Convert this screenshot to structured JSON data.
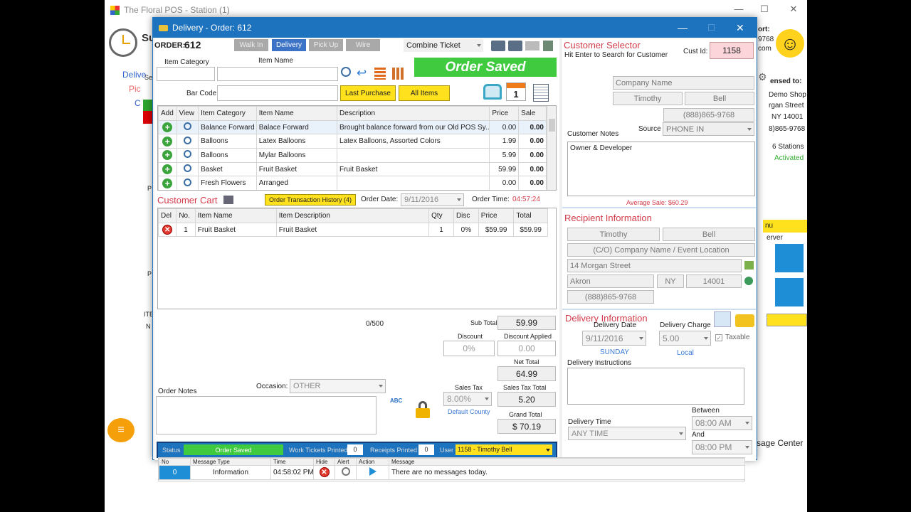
{
  "main_window": {
    "title": "The Floral POS - Station (1)",
    "side_labels": [
      "Su",
      "Delive",
      "Pic",
      "C",
      "P",
      "P",
      "ITE",
      "N",
      "Se"
    ],
    "right_labels": [
      "ort:",
      "9768",
      "com",
      "ensed to:",
      "Demo Shop",
      "rgan Street",
      "NY 14001",
      "8)865-9768",
      "6 Stations",
      "Activated",
      "nu",
      "erver",
      "sage Center"
    ]
  },
  "dialog": {
    "title": "Delivery - Order: 612",
    "order_label": "ORDER:",
    "order_number": "612"
  },
  "order_types": [
    {
      "label": "Walk In",
      "active": false
    },
    {
      "label": "Delivery",
      "active": true
    },
    {
      "label": "Pick Up",
      "active": false
    },
    {
      "label": "Wire",
      "active": false
    }
  ],
  "combine_ticket": "Combine Ticket",
  "order_saved_banner": "Order Saved",
  "item_search": {
    "category_label": "Item Category",
    "name_label": "Item Name",
    "barcode_label": "Bar Code",
    "last_purchase": "Last Purchase",
    "all_items": "All Items",
    "calendar_day": "1"
  },
  "items_table": {
    "headers": [
      "Add",
      "View",
      "Item Category",
      "Item Name",
      "Description",
      "Price",
      "Sale"
    ],
    "rows": [
      {
        "category": "Balance Forward",
        "name": "Balace Forward",
        "description": "Brought balance forward from our Old POS Sy...",
        "price": "0.00",
        "sale": "0.00"
      },
      {
        "category": "Balloons",
        "name": "Latex Balloons",
        "description": "Latex Balloons, Assorted Colors",
        "price": "1.99",
        "sale": "0.00"
      },
      {
        "category": "Balloons",
        "name": "Mylar Balloons",
        "description": "",
        "price": "5.99",
        "sale": "0.00"
      },
      {
        "category": "Basket",
        "name": "Fruit Basket",
        "description": "Fruit Basket",
        "price": "59.99",
        "sale": "0.00"
      },
      {
        "category": "Fresh Flowers",
        "name": "Arranged",
        "description": "",
        "price": "0.00",
        "sale": "0.00"
      }
    ]
  },
  "cart": {
    "title": "Customer Cart",
    "history_btn": "Order Transaction History (4)",
    "order_date_label": "Order Date:",
    "order_date": "9/11/2016",
    "order_time_label": "Order Time:",
    "order_time": "04:57:24",
    "headers": [
      "Del",
      "No.",
      "Item Name",
      "Item Description",
      "Qty",
      "Disc",
      "Price",
      "Total"
    ],
    "rows": [
      {
        "no": "1",
        "name": "Fruit Basket",
        "description": "Fruit Basket",
        "qty": "1",
        "disc": "0%",
        "price": "$59.99",
        "total": "$59.99"
      }
    ]
  },
  "totals": {
    "char_count": "0/500",
    "sub_total_label": "Sub Total",
    "sub_total": "59.99",
    "discount_label": "Discount",
    "discount": "0%",
    "discount_applied_label": "Discount Applied",
    "discount_applied": "0.00",
    "net_total_label": "Net Total",
    "net_total": "64.99",
    "sales_tax_label": "Sales Tax",
    "sales_tax": "8.00%",
    "default_county": "Default County",
    "sales_tax_total_label": "Sales Tax Total",
    "sales_tax_total": "5.20",
    "grand_total_label": "Grand Total",
    "grand_total": "$ 70.19"
  },
  "order_notes": {
    "label": "Order Notes",
    "occasion_label": "Occasion:",
    "occasion": "OTHER",
    "spell": "ABC"
  },
  "status_bar": {
    "status_label": "Status",
    "status": "Order Saved",
    "work_tickets_label": "Work Tickets Printed",
    "work_tickets": "0",
    "receipts_label": "Receipts Printed",
    "receipts": "0",
    "user_label": "User",
    "user": "1158 - Timothy Bell"
  },
  "customer": {
    "title": "Customer Selector",
    "hint": "Hit Enter to Search for Customer",
    "cust_id_label": "Cust Id:",
    "cust_id": "1158",
    "company_placeholder": "Company Name",
    "first": "Timothy",
    "last": "Bell",
    "phone": "(888)865-9768",
    "notes_label": "Customer Notes",
    "source_label": "Source",
    "source": "PHONE IN",
    "notes": "Owner & Developer",
    "avg_sale": "Average Sale: $60.29"
  },
  "recipient": {
    "title": "Recipient Information",
    "first": "Timothy",
    "last": "Bell",
    "company_placeholder": "(C/O) Company Name / Event Location",
    "street": "14 Morgan Street",
    "city": "Akron",
    "state": "NY",
    "zip": "14001",
    "phone": "(888)865-9768"
  },
  "delivery": {
    "title": "Delivery Information",
    "date_label": "Delivery Date",
    "date": "9/11/2016",
    "weekday": "SUNDAY",
    "charge_label": "Delivery Charge",
    "charge": "5.00",
    "local": "Local",
    "taxable": "Taxable",
    "instructions_label": "Delivery Instructions",
    "time_label": "Delivery Time",
    "time": "ANY TIME",
    "between_label": "Between",
    "from": "08:00 AM",
    "and_label": "And",
    "to": "08:00 PM"
  },
  "messages": {
    "headers": [
      "No",
      "Message Type",
      "Time",
      "Hide",
      "Alert",
      "Action",
      "Message"
    ],
    "row": {
      "no": "0",
      "type": "Information",
      "time": "04:58:02 PM",
      "message": "There are no messages today."
    }
  },
  "colors": {
    "titlebar": "#1e73be",
    "saved_green": "#3fca3f",
    "yellow": "#ffe11e",
    "red_label": "#d23b4a"
  }
}
